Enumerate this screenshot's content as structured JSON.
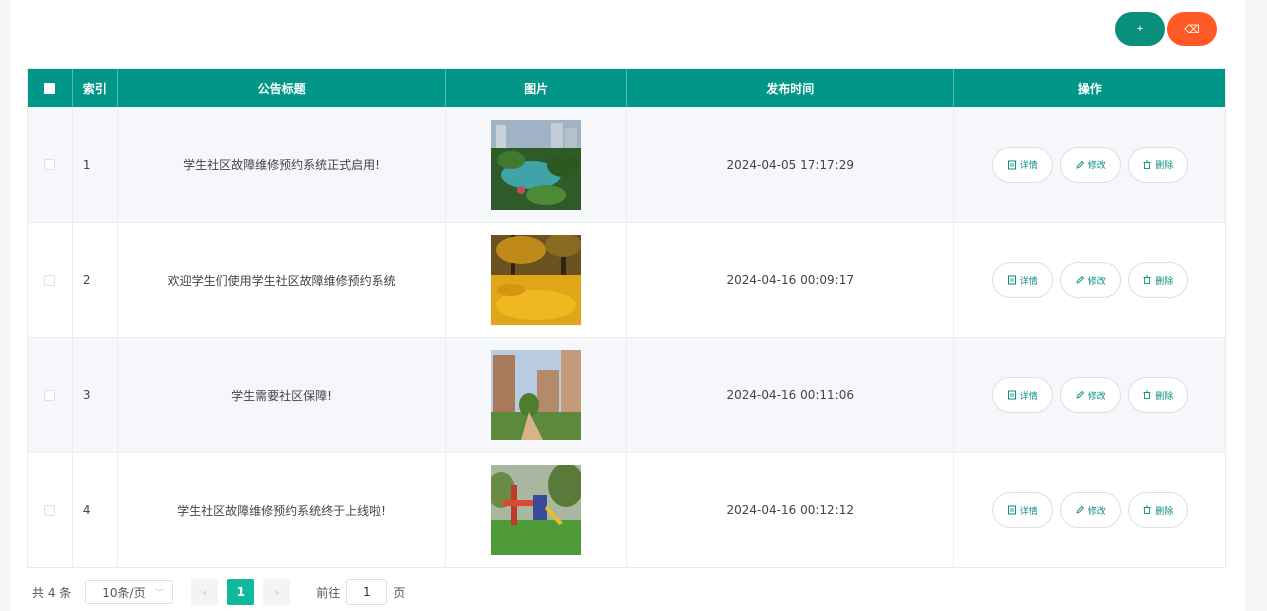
{
  "toolbar": {
    "add_label": "+",
    "delete_label": "⌫"
  },
  "table": {
    "headers": [
      "索引",
      "公告标题",
      "图片",
      "发布时间",
      "操作"
    ],
    "rows": [
      {
        "index": "1",
        "title": "学生社区故障维修预约系统正式启用!",
        "time": "2024-04-05 17:17:29",
        "image": "garden-pond"
      },
      {
        "index": "2",
        "title": "欢迎学生们使用学生社区故障维修预约系统",
        "time": "2024-04-16 00:09:17",
        "image": "autumn-leaves"
      },
      {
        "index": "3",
        "title": "学生需要社区保障!",
        "time": "2024-04-16 00:11:06",
        "image": "apartment-path"
      },
      {
        "index": "4",
        "title": "学生社区故障维修预约系统终于上线啦!",
        "time": "2024-04-16 00:12:12",
        "image": "playground"
      }
    ],
    "ops": {
      "detail": "详情",
      "edit": "修改",
      "remove": "删除"
    }
  },
  "pager": {
    "total": "共 4 条",
    "page_size": "10条/页",
    "current": "1",
    "goto_prefix": "前往",
    "goto_value": "1",
    "goto_suffix": "页"
  },
  "colors": {
    "header": "#009688",
    "accent": "#0a8f7d",
    "danger": "#ff5a26",
    "page_active": "#0fb99b"
  }
}
